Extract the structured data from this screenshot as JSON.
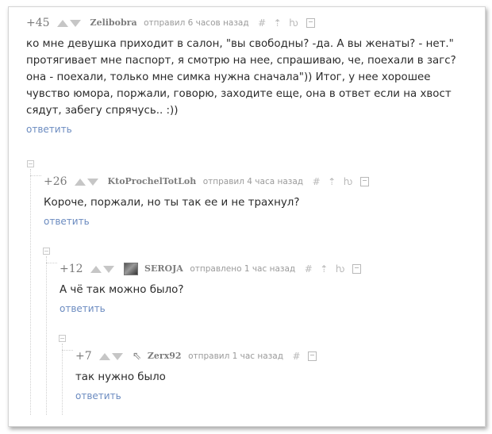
{
  "comments": [
    {
      "rating": "+45",
      "author": "Zelibobra",
      "sent": "отправил 6 часов назад",
      "text": "ко мне девушка приходит в салон, \"вы свободны? -да. А вы женаты? - нет.\" протягивает мне паспорт, я смотрю на нее, спрашиваю, че, поехали в загс? она - поехали, только мне симка нужна сначала\")) Итог, у нее хорошее чувство юмора, поржали, говорю, заходите еще, она в ответ если на хвост сядут, забегу спрячусь.. :))",
      "reply": "ответить"
    },
    {
      "rating": "+26",
      "author": "KtoProchelTotLoh",
      "sent": "отправил 4 часа назад",
      "text": "Короче, поржали, но ты так ее и не трахнул?",
      "reply": "ответить"
    },
    {
      "rating": "+12",
      "author": "SEROJA",
      "sent": "отправлено 1 час назад",
      "text": "А чё так можно было?",
      "reply": "ответить"
    },
    {
      "rating": "+7",
      "author": "Zerx92",
      "sent": "отправил 1 час назад",
      "text": "так нужно было",
      "reply": "ответить"
    }
  ],
  "icons": {
    "hash": "#",
    "up_arrow": "⇡",
    "parent": "ƕ",
    "cursor": "⇖"
  }
}
